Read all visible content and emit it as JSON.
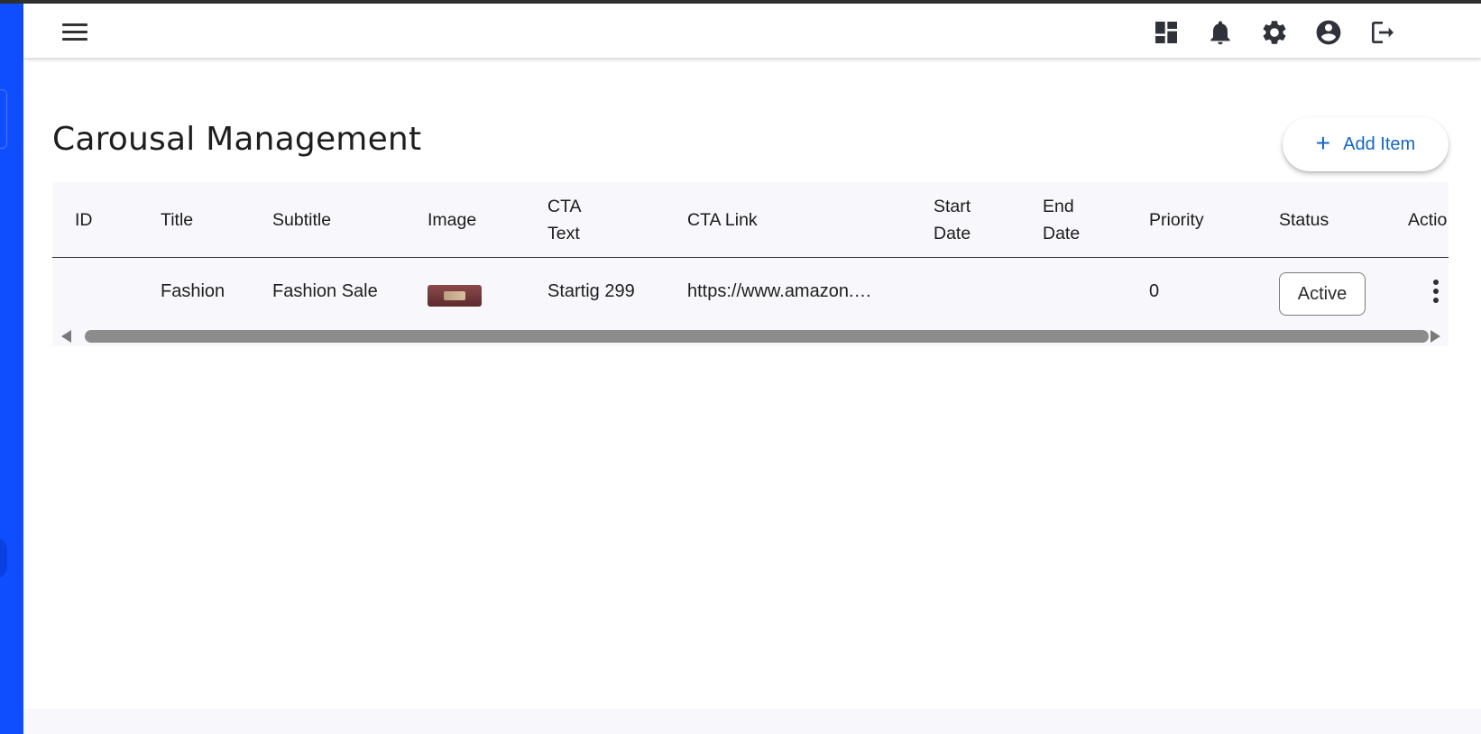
{
  "page": {
    "title": "Carousal Management",
    "add_button_label": "Add Item"
  },
  "appbar": {
    "icons": [
      "menu-icon",
      "dashboard-icon",
      "bell-icon",
      "gear-icon",
      "account-circle-icon",
      "logout-icon"
    ]
  },
  "table": {
    "columns": [
      "ID",
      "Title",
      "Subtitle",
      "Image",
      "CTA\nText",
      "CTA Link",
      "Start\nDate",
      "End\nDate",
      "Priority",
      "Status",
      "Actio"
    ],
    "rows": [
      {
        "id": "",
        "title": "Fashion",
        "subtitle": "Fashion Sale",
        "image": "thumbnail",
        "cta_text": "Startig 299",
        "cta_link": "https://www.amazon.…",
        "start_date": "",
        "end_date": "",
        "priority": "0",
        "status": "Active"
      }
    ]
  },
  "colors": {
    "sidebar": "#0f4eff",
    "accent": "#1565c0",
    "table_bg": "#f8f8fc"
  }
}
